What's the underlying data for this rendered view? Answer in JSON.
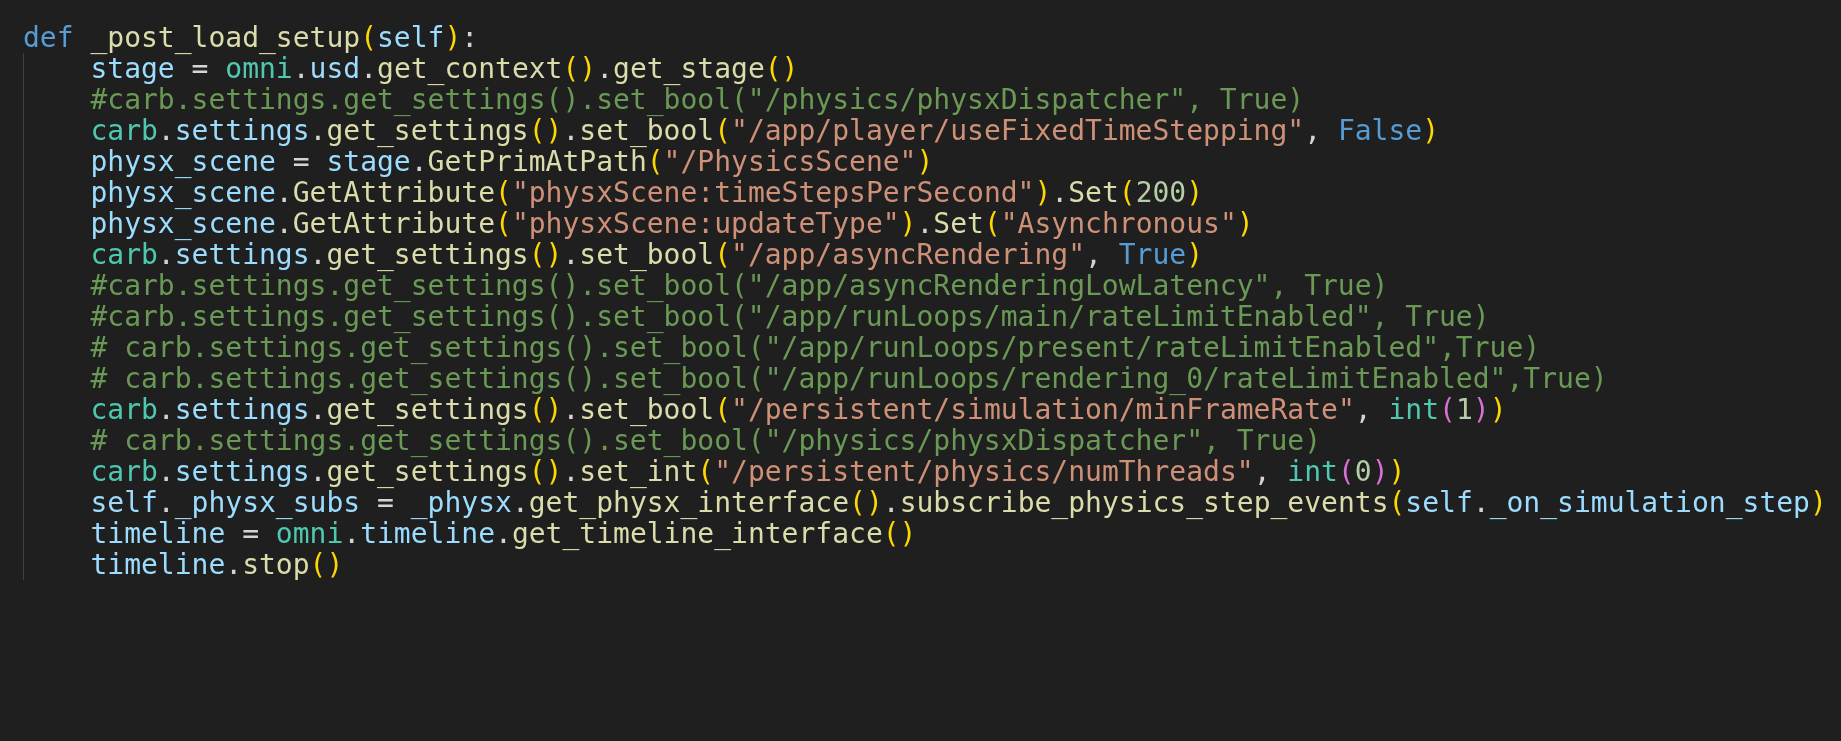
{
  "editor": {
    "lines": [
      {
        "tokens": [
          {
            "kind": "keyword",
            "text": "def"
          },
          {
            "kind": "function",
            "text": " _post_load_setup"
          },
          {
            "kind": "bracket1",
            "text": "("
          },
          {
            "kind": "variable",
            "text": "self"
          },
          {
            "kind": "bracket1",
            "text": ")"
          },
          {
            "kind": "plain",
            "text": ":"
          }
        ],
        "children": [
          {
            "tokens": [
              {
                "kind": "variable",
                "text": "stage"
              },
              {
                "kind": "plain",
                "text": " = "
              },
              {
                "kind": "module",
                "text": "omni"
              },
              {
                "kind": "plain",
                "text": "."
              },
              {
                "kind": "variable",
                "text": "usd"
              },
              {
                "kind": "plain",
                "text": "."
              },
              {
                "kind": "function",
                "text": "get_context"
              },
              {
                "kind": "bracket1",
                "text": "()"
              },
              {
                "kind": "plain",
                "text": "."
              },
              {
                "kind": "function",
                "text": "get_stage"
              },
              {
                "kind": "bracket1",
                "text": "()"
              }
            ]
          },
          {
            "tokens": [
              {
                "kind": "comment",
                "text": "#carb.settings.get_settings().set_bool(\"/physics/physxDispatcher\", True)"
              }
            ]
          },
          {
            "tokens": [
              {
                "kind": "module",
                "text": "carb"
              },
              {
                "kind": "plain",
                "text": "."
              },
              {
                "kind": "variable",
                "text": "settings"
              },
              {
                "kind": "plain",
                "text": "."
              },
              {
                "kind": "function",
                "text": "get_settings"
              },
              {
                "kind": "bracket1",
                "text": "()"
              },
              {
                "kind": "plain",
                "text": "."
              },
              {
                "kind": "function",
                "text": "set_bool"
              },
              {
                "kind": "bracket1",
                "text": "("
              },
              {
                "kind": "string",
                "text": "\"/app/player/useFixedTimeStepping\""
              },
              {
                "kind": "plain",
                "text": ", "
              },
              {
                "kind": "constant",
                "text": "False"
              },
              {
                "kind": "bracket1",
                "text": ")"
              }
            ]
          },
          {
            "tokens": [
              {
                "kind": "variable",
                "text": "physx_scene"
              },
              {
                "kind": "plain",
                "text": " = "
              },
              {
                "kind": "variable",
                "text": "stage"
              },
              {
                "kind": "plain",
                "text": "."
              },
              {
                "kind": "function",
                "text": "GetPrimAtPath"
              },
              {
                "kind": "bracket1",
                "text": "("
              },
              {
                "kind": "string",
                "text": "\"/PhysicsScene\""
              },
              {
                "kind": "bracket1",
                "text": ")"
              }
            ]
          },
          {
            "tokens": [
              {
                "kind": "variable",
                "text": "physx_scene"
              },
              {
                "kind": "plain",
                "text": "."
              },
              {
                "kind": "function",
                "text": "GetAttribute"
              },
              {
                "kind": "bracket1",
                "text": "("
              },
              {
                "kind": "string",
                "text": "\"physxScene:timeStepsPerSecond\""
              },
              {
                "kind": "bracket1",
                "text": ")"
              },
              {
                "kind": "plain",
                "text": "."
              },
              {
                "kind": "function",
                "text": "Set"
              },
              {
                "kind": "bracket1",
                "text": "("
              },
              {
                "kind": "number",
                "text": "200"
              },
              {
                "kind": "bracket1",
                "text": ")"
              }
            ]
          },
          {
            "tokens": [
              {
                "kind": "variable",
                "text": "physx_scene"
              },
              {
                "kind": "plain",
                "text": "."
              },
              {
                "kind": "function",
                "text": "GetAttribute"
              },
              {
                "kind": "bracket1",
                "text": "("
              },
              {
                "kind": "string",
                "text": "\"physxScene:updateType\""
              },
              {
                "kind": "bracket1",
                "text": ")"
              },
              {
                "kind": "plain",
                "text": "."
              },
              {
                "kind": "function",
                "text": "Set"
              },
              {
                "kind": "bracket1",
                "text": "("
              },
              {
                "kind": "string",
                "text": "\"Asynchronous\""
              },
              {
                "kind": "bracket1",
                "text": ")"
              }
            ]
          },
          {
            "tokens": [
              {
                "kind": "module",
                "text": "carb"
              },
              {
                "kind": "plain",
                "text": "."
              },
              {
                "kind": "variable",
                "text": "settings"
              },
              {
                "kind": "plain",
                "text": "."
              },
              {
                "kind": "function",
                "text": "get_settings"
              },
              {
                "kind": "bracket1",
                "text": "()"
              },
              {
                "kind": "plain",
                "text": "."
              },
              {
                "kind": "function",
                "text": "set_bool"
              },
              {
                "kind": "bracket1",
                "text": "("
              },
              {
                "kind": "string",
                "text": "\"/app/asyncRendering\""
              },
              {
                "kind": "plain",
                "text": ", "
              },
              {
                "kind": "constant",
                "text": "True"
              },
              {
                "kind": "bracket1",
                "text": ")"
              }
            ]
          },
          {
            "tokens": [
              {
                "kind": "comment",
                "text": "#carb.settings.get_settings().set_bool(\"/app/asyncRenderingLowLatency\", True)"
              }
            ]
          },
          {
            "tokens": [
              {
                "kind": "comment",
                "text": "#carb.settings.get_settings().set_bool(\"/app/runLoops/main/rateLimitEnabled\", True)"
              }
            ]
          },
          {
            "tokens": [
              {
                "kind": "comment",
                "text": "# carb.settings.get_settings().set_bool(\"/app/runLoops/present/rateLimitEnabled\",True)"
              }
            ]
          },
          {
            "tokens": [
              {
                "kind": "comment",
                "text": "# carb.settings.get_settings().set_bool(\"/app/runLoops/rendering_0/rateLimitEnabled\",True)"
              }
            ]
          },
          {
            "tokens": [
              {
                "kind": "module",
                "text": "carb"
              },
              {
                "kind": "plain",
                "text": "."
              },
              {
                "kind": "variable",
                "text": "settings"
              },
              {
                "kind": "plain",
                "text": "."
              },
              {
                "kind": "function",
                "text": "get_settings"
              },
              {
                "kind": "bracket1",
                "text": "()"
              },
              {
                "kind": "plain",
                "text": "."
              },
              {
                "kind": "function",
                "text": "set_bool"
              },
              {
                "kind": "bracket1",
                "text": "("
              },
              {
                "kind": "string",
                "text": "\"/persistent/simulation/minFrameRate\""
              },
              {
                "kind": "plain",
                "text": ", "
              },
              {
                "kind": "module",
                "text": "int"
              },
              {
                "kind": "bracket2",
                "text": "("
              },
              {
                "kind": "number",
                "text": "1"
              },
              {
                "kind": "bracket2",
                "text": ")"
              },
              {
                "kind": "bracket1",
                "text": ")"
              }
            ]
          },
          {
            "tokens": [
              {
                "kind": "comment",
                "text": "# carb.settings.get_settings().set_bool(\"/physics/physxDispatcher\", True)"
              }
            ]
          },
          {
            "tokens": [
              {
                "kind": "module",
                "text": "carb"
              },
              {
                "kind": "plain",
                "text": "."
              },
              {
                "kind": "variable",
                "text": "settings"
              },
              {
                "kind": "plain",
                "text": "."
              },
              {
                "kind": "function",
                "text": "get_settings"
              },
              {
                "kind": "bracket1",
                "text": "()"
              },
              {
                "kind": "plain",
                "text": "."
              },
              {
                "kind": "function",
                "text": "set_int"
              },
              {
                "kind": "bracket1",
                "text": "("
              },
              {
                "kind": "string",
                "text": "\"/persistent/physics/numThreads\""
              },
              {
                "kind": "plain",
                "text": ", "
              },
              {
                "kind": "module",
                "text": "int"
              },
              {
                "kind": "bracket2",
                "text": "("
              },
              {
                "kind": "number",
                "text": "0"
              },
              {
                "kind": "bracket2",
                "text": ")"
              },
              {
                "kind": "bracket1",
                "text": ")"
              }
            ]
          },
          {
            "tokens": [
              {
                "kind": "variable",
                "text": "self"
              },
              {
                "kind": "plain",
                "text": "."
              },
              {
                "kind": "variable",
                "text": "_physx_subs"
              },
              {
                "kind": "plain",
                "text": " = "
              },
              {
                "kind": "variable",
                "text": "_physx"
              },
              {
                "kind": "plain",
                "text": "."
              },
              {
                "kind": "function",
                "text": "get_physx_interface"
              },
              {
                "kind": "bracket1",
                "text": "()"
              },
              {
                "kind": "plain",
                "text": "."
              },
              {
                "kind": "function",
                "text": "subscribe_physics_step_events"
              },
              {
                "kind": "bracket1",
                "text": "("
              },
              {
                "kind": "variable",
                "text": "self"
              },
              {
                "kind": "plain",
                "text": "."
              },
              {
                "kind": "variable",
                "text": "_on_simulation_step"
              },
              {
                "kind": "bracket1",
                "text": ")"
              }
            ]
          },
          {
            "tokens": [
              {
                "kind": "variable",
                "text": "timeline"
              },
              {
                "kind": "plain",
                "text": " = "
              },
              {
                "kind": "module",
                "text": "omni"
              },
              {
                "kind": "plain",
                "text": "."
              },
              {
                "kind": "variable",
                "text": "timeline"
              },
              {
                "kind": "plain",
                "text": "."
              },
              {
                "kind": "function",
                "text": "get_timeline_interface"
              },
              {
                "kind": "bracket1",
                "text": "()"
              }
            ]
          },
          {
            "tokens": [
              {
                "kind": "variable",
                "text": "timeline"
              },
              {
                "kind": "plain",
                "text": "."
              },
              {
                "kind": "function",
                "text": "stop"
              },
              {
                "kind": "bracket1",
                "text": "()"
              }
            ]
          }
        ]
      }
    ]
  }
}
